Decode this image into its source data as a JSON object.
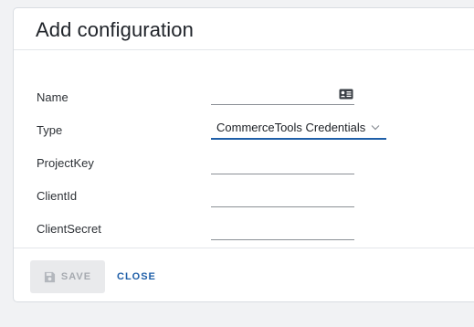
{
  "dialog": {
    "title": "Add configuration",
    "fields": {
      "name": {
        "label": "Name",
        "value": "",
        "icon": "contact-card-icon"
      },
      "type": {
        "label": "Type",
        "value": "CommerceTools Credentials",
        "icon": "chevron-down-icon"
      },
      "project_key": {
        "label": "ProjectKey",
        "value": ""
      },
      "client_id": {
        "label": "ClientId",
        "value": ""
      },
      "client_secret": {
        "label": "ClientSecret",
        "value": ""
      }
    },
    "footer": {
      "save_label": "SAVE",
      "save_icon": "save-icon",
      "close_label": "CLOSE"
    }
  },
  "colors": {
    "accent": "#1f5fa8",
    "disabled_button_bg": "#e9eaec",
    "disabled_button_text": "#a6aab0",
    "page_bg": "#f1f2f4"
  }
}
